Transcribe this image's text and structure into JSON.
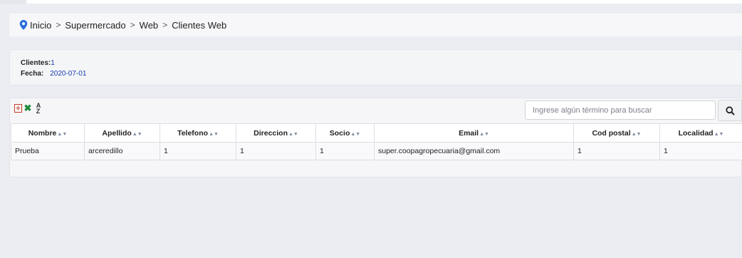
{
  "breadcrumb": {
    "items": [
      "Inicio",
      "Supermercado",
      "Web",
      "Clientes Web"
    ],
    "separator": ">"
  },
  "summary": {
    "clientes_label": "Clientes:",
    "clientes_value": "1",
    "fecha_label": "Fecha:",
    "fecha_value": "2020-07-01"
  },
  "toolbar": {
    "icons": [
      "pdf-export-icon",
      "excel-export-icon",
      "sort-az-icon"
    ],
    "search_placeholder": "Ingrese algún término para buscar",
    "search_value": ""
  },
  "table": {
    "sort_glyph": "▲▼",
    "columns": [
      "Nombre",
      "Apellido",
      "Telefono",
      "Direccion",
      "Socio",
      "Email",
      "Cod postal",
      "Localidad"
    ],
    "rows": [
      [
        "Prueba",
        "arceredillo",
        "1",
        "1",
        "1",
        "super.coopagropecuaria@gmail.com",
        "1",
        "1"
      ]
    ]
  },
  "colors": {
    "accent": "#1a3db0",
    "background": "#ebedf2",
    "pin_icon": "#2a6fdb"
  }
}
